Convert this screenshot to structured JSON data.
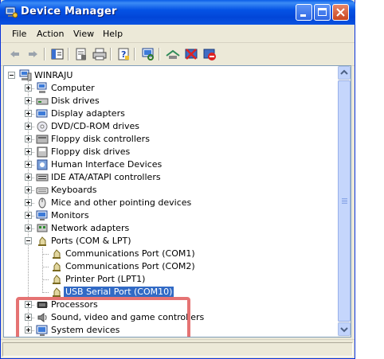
{
  "window": {
    "title": "Device Manager"
  },
  "menu": [
    "File",
    "Action",
    "View",
    "Help"
  ],
  "toolbar": {
    "icons": [
      "back-arrow-icon",
      "forward-arrow-icon",
      "show-hide-console-tree-icon",
      "properties-icon",
      "print-icon",
      "help-icon",
      "scan-hardware-icon",
      "update-driver-icon",
      "uninstall-icon",
      "disable-icon"
    ]
  },
  "tree": {
    "root": "WINRAJU",
    "categories": [
      {
        "label": "Computer",
        "icon": "computer-icon"
      },
      {
        "label": "Disk drives",
        "icon": "disk-drive-icon"
      },
      {
        "label": "Display adapters",
        "icon": "display-adapter-icon"
      },
      {
        "label": "DVD/CD-ROM drives",
        "icon": "dvd-drive-icon"
      },
      {
        "label": "Floppy disk controllers",
        "icon": "floppy-controller-icon"
      },
      {
        "label": "Floppy disk drives",
        "icon": "floppy-drive-icon"
      },
      {
        "label": "Human Interface Devices",
        "icon": "hid-icon"
      },
      {
        "label": "IDE ATA/ATAPI controllers",
        "icon": "ide-controller-icon"
      },
      {
        "label": "Keyboards",
        "icon": "keyboard-icon"
      },
      {
        "label": "Mice and other pointing devices",
        "icon": "mouse-icon"
      },
      {
        "label": "Monitors",
        "icon": "monitor-icon"
      },
      {
        "label": "Network adapters",
        "icon": "network-adapter-icon"
      }
    ],
    "ports": {
      "label": "Ports (COM & LPT)",
      "children": [
        {
          "label": "Communications Port (COM1)"
        },
        {
          "label": "Communications Port (COM2)"
        },
        {
          "label": "Printer Port (LPT1)"
        },
        {
          "label": "USB Serial Port (COM10)",
          "selected": true
        }
      ]
    },
    "after": [
      {
        "label": "Processors",
        "icon": "processor-icon"
      },
      {
        "label": "Sound, video and game controllers",
        "icon": "sound-icon"
      },
      {
        "label": "System devices",
        "icon": "system-devices-icon"
      }
    ]
  },
  "colors": {
    "title_bar": "#0553e5",
    "selection": "#316ac5",
    "highlight_box": "#e57373"
  }
}
